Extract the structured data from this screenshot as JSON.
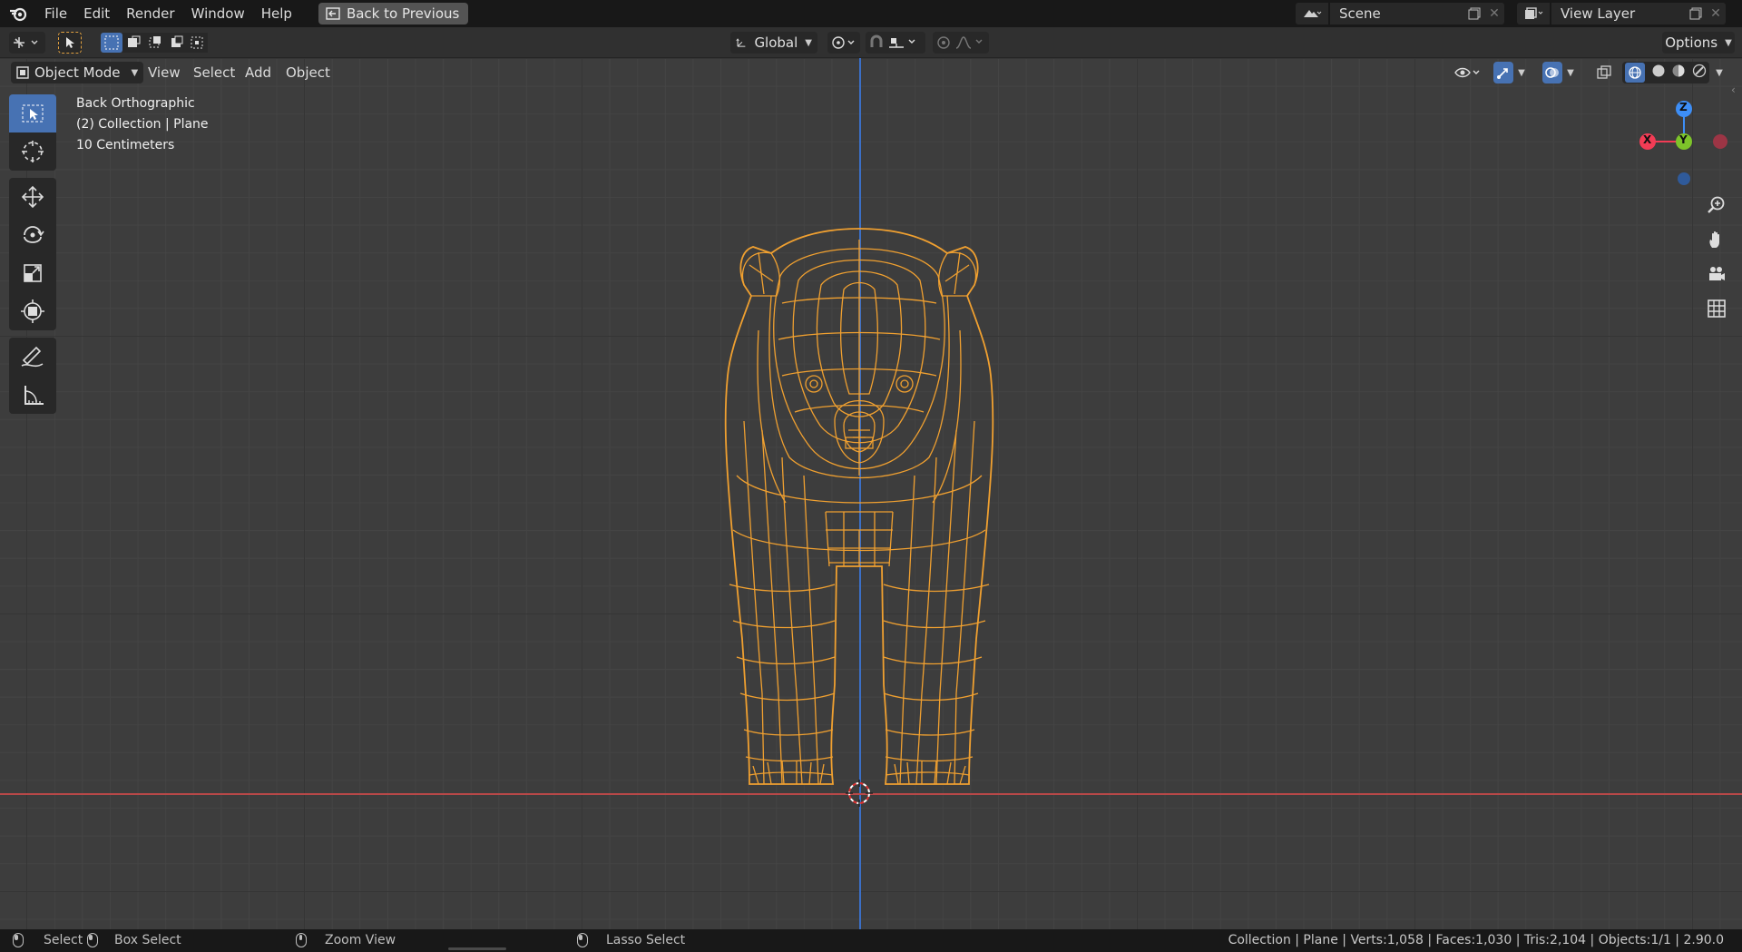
{
  "topbar": {
    "menus": [
      "File",
      "Edit",
      "Render",
      "Window",
      "Help"
    ],
    "back_button": "Back to Previous",
    "scene_label": "Scene",
    "view_layer_label": "View Layer"
  },
  "header": {
    "transform_orientation": "Global",
    "options_label": "Options"
  },
  "viewport_header": {
    "mode": "Object Mode",
    "menus": [
      "View",
      "Select",
      "Add",
      "Object"
    ]
  },
  "overlay": {
    "view_name": "Back Orthographic",
    "collection": "(2) Collection | Plane",
    "scale": "10 Centimeters"
  },
  "gizmo": {
    "z_label": "Z",
    "x_label": "X",
    "y_label": "Y",
    "colors": {
      "x": "#f23c55",
      "y": "#7dc42a",
      "z": "#3d8ef6",
      "selected": "#f0a030"
    }
  },
  "toolbar": {
    "tools": [
      "select-box",
      "cursor",
      "move",
      "rotate",
      "scale",
      "transform",
      "annotate",
      "measure"
    ]
  },
  "statusbar": {
    "select": "Select",
    "box_select": "Box Select",
    "zoom_view": "Zoom View",
    "lasso_select": "Lasso Select",
    "info": "Collection | Plane | Verts:1,058 | Faces:1,030 | Tris:2,104 | Objects:1/1 | 2.90.0"
  }
}
